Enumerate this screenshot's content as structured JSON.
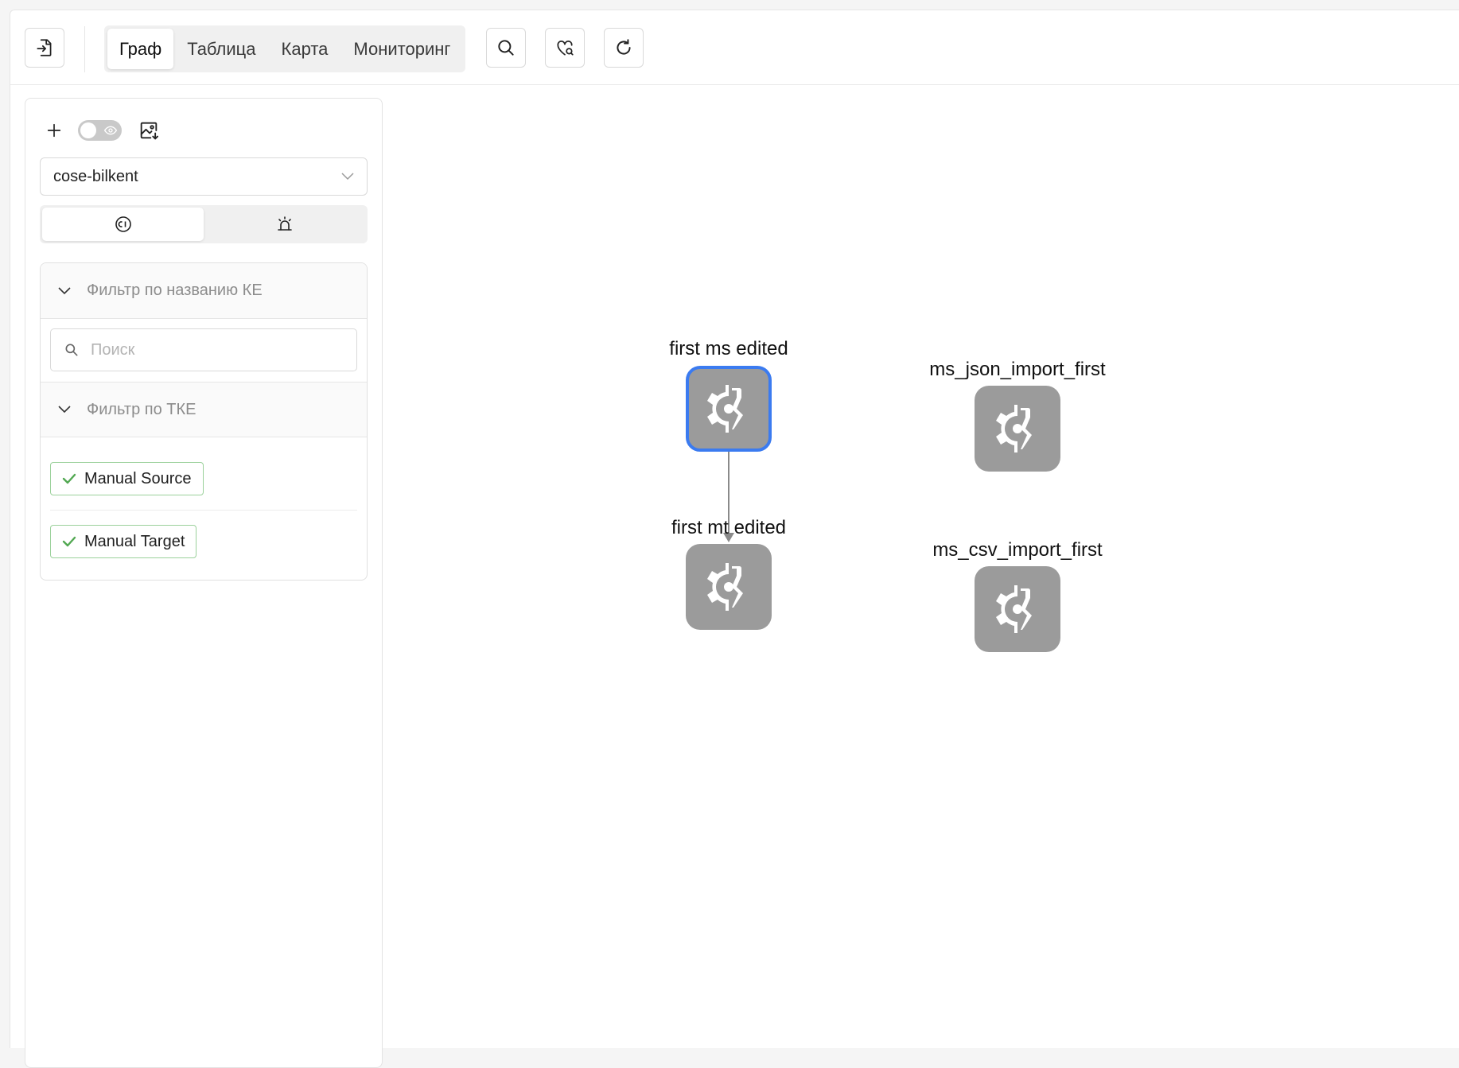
{
  "toolbar": {
    "tabs": [
      {
        "label": "Граф",
        "active": true
      },
      {
        "label": "Таблица",
        "active": false
      },
      {
        "label": "Карта",
        "active": false
      },
      {
        "label": "Мониторинг",
        "active": false
      }
    ],
    "icons": [
      "import-file-icon",
      "search-icon",
      "favorite-search-icon",
      "refresh-icon"
    ]
  },
  "panel": {
    "layout_select": {
      "value": "cose-bilkent"
    },
    "mode_options": [
      {
        "icon": "ci-icon",
        "active": true
      },
      {
        "icon": "alarm-icon",
        "active": false
      }
    ],
    "filter_name": {
      "header": "Фильтр по названию КЕ",
      "search_placeholder": "Поиск"
    },
    "filter_type": {
      "header": "Фильтр по ТКЕ",
      "tags": [
        {
          "label": "Manual Source",
          "checked": true
        },
        {
          "label": "Manual Target",
          "checked": true
        }
      ]
    }
  },
  "graph": {
    "nodes": [
      {
        "label": "first ms edited",
        "selected": true
      },
      {
        "label": "first mt edited",
        "selected": false
      },
      {
        "label": "ms_json_import_first",
        "selected": false
      },
      {
        "label": "ms_csv_import_first",
        "selected": false
      }
    ],
    "edges": [
      {
        "from": "first ms edited",
        "to": "first mt edited"
      }
    ],
    "colors": {
      "node": "#9b9b9b",
      "selected_border": "#3b7bf0",
      "edge": "#8a8a8a",
      "tag_check": "#52a852"
    }
  }
}
